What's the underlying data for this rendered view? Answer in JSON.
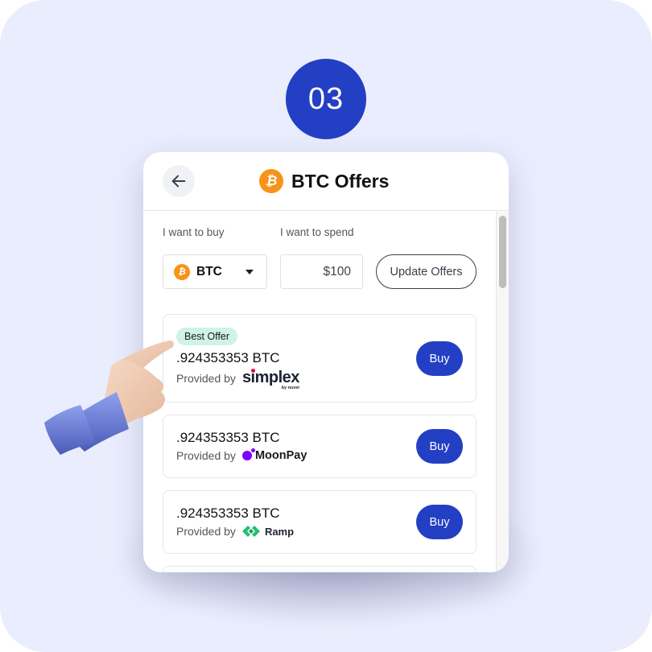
{
  "step": {
    "label": "03"
  },
  "header": {
    "back_icon": "arrow-left-icon",
    "coin_icon": "bitcoin-icon",
    "title": "BTC Offers"
  },
  "form": {
    "buy_label": "I want to buy",
    "buy_value": "BTC",
    "spend_label": "I want to spend",
    "spend_value": "$100",
    "update_button": "Update Offers"
  },
  "offers": [
    {
      "badge": "Best Offer",
      "amount": ".924353353 BTC",
      "provided_by": "Provided by",
      "provider": "simplex",
      "provider_sub": "by nuvei",
      "buy_label": "Buy"
    },
    {
      "amount": ".924353353 BTC",
      "provided_by": "Provided by",
      "provider": "MoonPay",
      "buy_label": "Buy"
    },
    {
      "amount": ".924353353 BTC",
      "provided_by": "Provided by",
      "provider": "Ramp",
      "buy_label": "Buy"
    }
  ],
  "colors": {
    "accent": "#233fc4",
    "bitcoin": "#f7931a",
    "badge_bg": "#cff3e6",
    "background": "#eaedfd"
  }
}
